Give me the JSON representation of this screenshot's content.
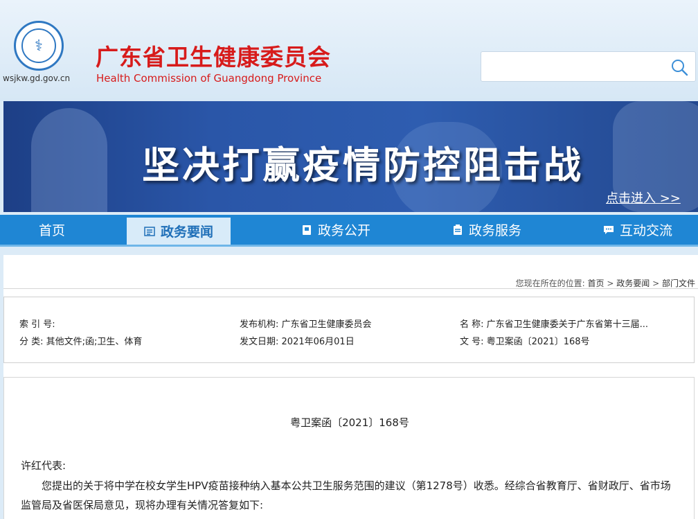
{
  "header": {
    "site_url": "wsjkw.gd.gov.cn",
    "title": "广东省卫生健康委员会",
    "subtitle": "Health Commission of Guangdong Province",
    "search_placeholder": "",
    "search_icon": "search-icon"
  },
  "banner": {
    "title": "坚决打赢疫情防控阻击战",
    "link": "点击进入 >>"
  },
  "nav": {
    "items": [
      {
        "label": "首页",
        "icon": ""
      },
      {
        "label": "政务要闻",
        "icon": "news-icon"
      },
      {
        "label": "政务公开",
        "icon": "document-icon"
      },
      {
        "label": "政务服务",
        "icon": "clipboard-icon"
      },
      {
        "label": "互动交流",
        "icon": "chat-icon"
      }
    ]
  },
  "breadcrumb": {
    "prefix": "您现在所在的位置:",
    "items": [
      "首页",
      "政务要闻",
      "部门文件"
    ],
    "sep": ">"
  },
  "meta": {
    "index_label": "索 引 号:",
    "index_value": "",
    "category_label": "分    类:",
    "category_value": "其他文件;函;卫生、体育",
    "publisher_label": "发布机构:",
    "publisher_value": "广东省卫生健康委员会",
    "date_label": "发文日期:",
    "date_value": "2021年06月01日",
    "name_label": "名        称:",
    "name_value": "广东省卫生健康委关于广东省第十三届...",
    "docno_label": "文        号:",
    "docno_value": "粤卫案函〔2021〕168号"
  },
  "document": {
    "number": "粤卫案函〔2021〕168号",
    "greeting": "许红代表:",
    "paragraph": "您提出的关于将中学在校女学生HPV疫苗接种纳入基本公共卫生服务范围的建议（第1278号）收悉。经综合省教育厅、省财政厅、省市场监管局及省医保局意见，现将办理有关情况答复如下:"
  },
  "colors": {
    "brand_red": "#d71b1b",
    "nav_blue": "#1f86d4",
    "banner_blue": "#2a56a8"
  }
}
